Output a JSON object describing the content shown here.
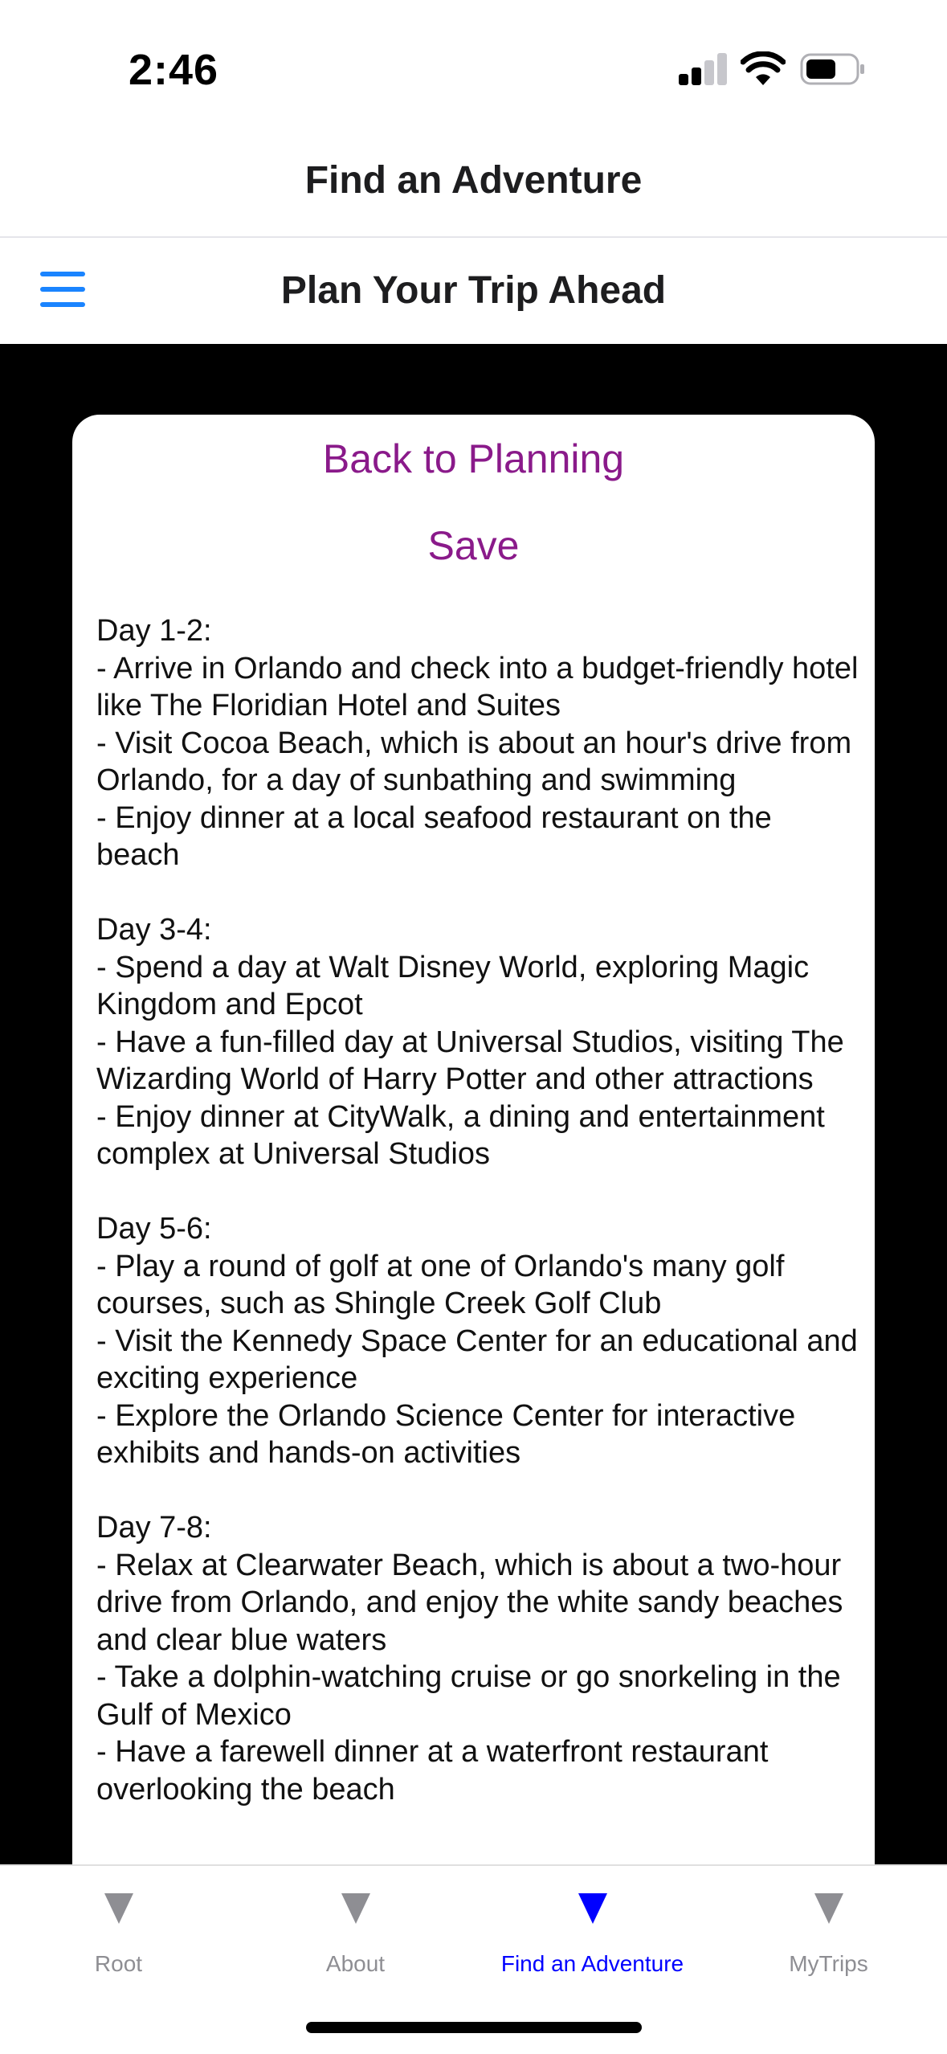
{
  "status_bar": {
    "time": "2:46",
    "icons": [
      "cellular-signal-icon",
      "wifi-icon",
      "battery-icon"
    ]
  },
  "header": {
    "title": "Find an Adventure"
  },
  "subheader": {
    "menu_icon": "hamburger-menu-icon",
    "title": "Plan Your Trip Ahead"
  },
  "card": {
    "back_label": "Back to Planning",
    "save_label": "Save",
    "itinerary_text": "Day 1-2:\n- Arrive in Orlando and check into a budget-friendly hotel like The Floridian Hotel and Suites\n- Visit Cocoa Beach, which is about an hour's drive from Orlando, for a day of sunbathing and swimming\n- Enjoy dinner at a local seafood restaurant on the beach\n\nDay 3-4:\n- Spend a day at Walt Disney World, exploring Magic Kingdom and Epcot\n- Have a fun-filled day at Universal Studios, visiting The Wizarding World of Harry Potter and other attractions\n- Enjoy dinner at CityWalk, a dining and entertainment complex at Universal Studios\n\nDay 5-6:\n- Play a round of golf at one of Orlando's many golf courses, such as Shingle Creek Golf Club\n- Visit the Kennedy Space Center for an educational and exciting experience\n- Explore the Orlando Science Center for interactive exhibits and hands-on activities\n\nDay 7-8:\n- Relax at Clearwater Beach, which is about a two-hour drive from Orlando, and enjoy the white sandy beaches and clear blue waters\n- Take a dolphin-watching cruise or go snorkeling in the Gulf of Mexico\n- Have a farewell dinner at a waterfront restaurant overlooking the beach"
  },
  "tab_bar": {
    "tabs": [
      {
        "label": "Root",
        "icon": "triangle-down-icon",
        "active": false
      },
      {
        "label": "About",
        "icon": "triangle-down-icon",
        "active": false
      },
      {
        "label": "Find an Adventure",
        "icon": "triangle-down-icon",
        "active": true
      },
      {
        "label": "MyTrips",
        "icon": "triangle-down-icon",
        "active": false
      }
    ]
  },
  "colors": {
    "accent_purple": "#8a1a8a",
    "menu_blue": "#1a84ff",
    "active_tab": "#0000ff",
    "inactive_tab": "#8e8e93",
    "content_background": "#000000"
  }
}
